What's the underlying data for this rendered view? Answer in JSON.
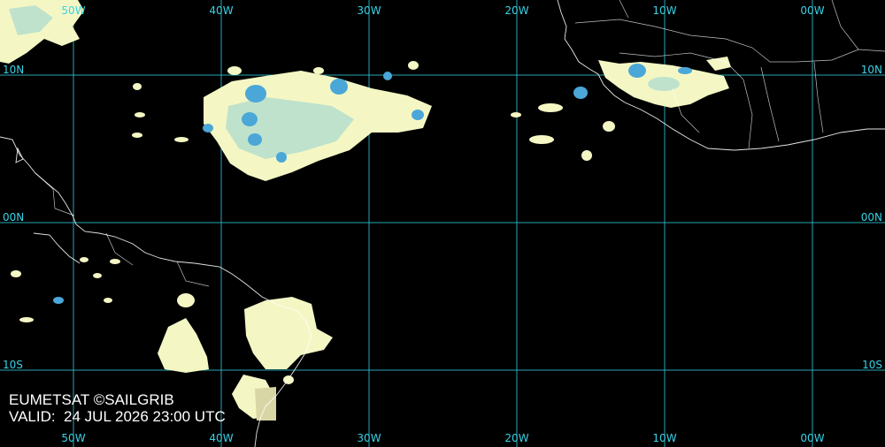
{
  "longitudes": [
    {
      "label": "50W",
      "lon": -50
    },
    {
      "label": "40W",
      "lon": -40
    },
    {
      "label": "30W",
      "lon": -30
    },
    {
      "label": "20W",
      "lon": -20
    },
    {
      "label": "10W",
      "lon": -10
    },
    {
      "label": "00W",
      "lon": 0
    }
  ],
  "latitudes": [
    {
      "label": "10N",
      "lat": 10
    },
    {
      "label": "00N",
      "lat": 0
    },
    {
      "label": "10S",
      "lat": -10
    }
  ],
  "caption": {
    "source": "EUMETSAT ©SAILGRIB",
    "valid": "VALID:  24 JUL 2026 23:00 UTC"
  },
  "colors": {
    "background": "#000000",
    "grid": "#2ec4d6",
    "cloud_light": "#f4f7c4",
    "cloud_cold": "#4aa7d8",
    "coastline": "#ffffff"
  }
}
